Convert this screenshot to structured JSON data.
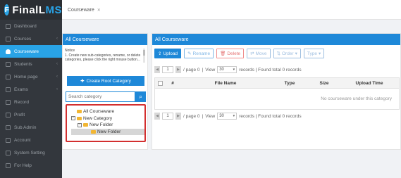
{
  "app": {
    "logo_prefix": "F",
    "logo_main": "FinalL",
    "logo_accent": "MS"
  },
  "breadcrumb": {
    "label": "Courseware",
    "close": "✕"
  },
  "sidebar": {
    "items": [
      {
        "label": "Dashboard",
        "icon": "home-icon"
      },
      {
        "label": "Courses",
        "icon": "book-icon"
      },
      {
        "label": "Courseware",
        "icon": "cloud-icon"
      },
      {
        "label": "Students",
        "icon": "users-icon"
      },
      {
        "label": "Home page",
        "icon": "list-icon"
      },
      {
        "label": "Exams",
        "icon": "exam-icon"
      },
      {
        "label": "Record",
        "icon": "record-icon"
      },
      {
        "label": "Profit",
        "icon": "profit-icon"
      },
      {
        "label": "Sub Admin",
        "icon": "admin-icon"
      },
      {
        "label": "Account",
        "icon": "dollar-icon"
      },
      {
        "label": "System Setting",
        "icon": "gear-icon"
      },
      {
        "label": "For Help",
        "icon": "help-icon"
      }
    ],
    "active_index": 2
  },
  "left_panel": {
    "title": "All Courseware",
    "notice_title": "Notice",
    "notice_text": "1. Create new sub-categories, rename, or delete categories, please click the right mouse button...",
    "create_button": "Create Root Category",
    "search_placeholder": "Search category",
    "tree": [
      {
        "label": "All Courseware",
        "toggle": ""
      },
      {
        "label": "New Category",
        "toggle": "−"
      },
      {
        "label": "New Folder",
        "toggle": "−"
      },
      {
        "label": "New Folder",
        "toggle": ""
      }
    ]
  },
  "right_panel": {
    "title": "All Courseware",
    "toolbar": {
      "upload": "Upload",
      "rename": "Rename",
      "delete": "Delete",
      "move": "Move",
      "order": "Order",
      "type": "Type"
    },
    "pager": {
      "page_value": "1",
      "page_text": "/ page 0",
      "view_label": "View",
      "page_size": "30",
      "summary": "records | Found total 0 records"
    },
    "columns": [
      "#",
      "File Name",
      "Type",
      "Size",
      "Upload Time"
    ],
    "empty_text": "No courseware under this category"
  },
  "colors": {
    "primary": "#1e88d8",
    "sidebar": "#33373d",
    "highlight": "#d32f2f"
  }
}
